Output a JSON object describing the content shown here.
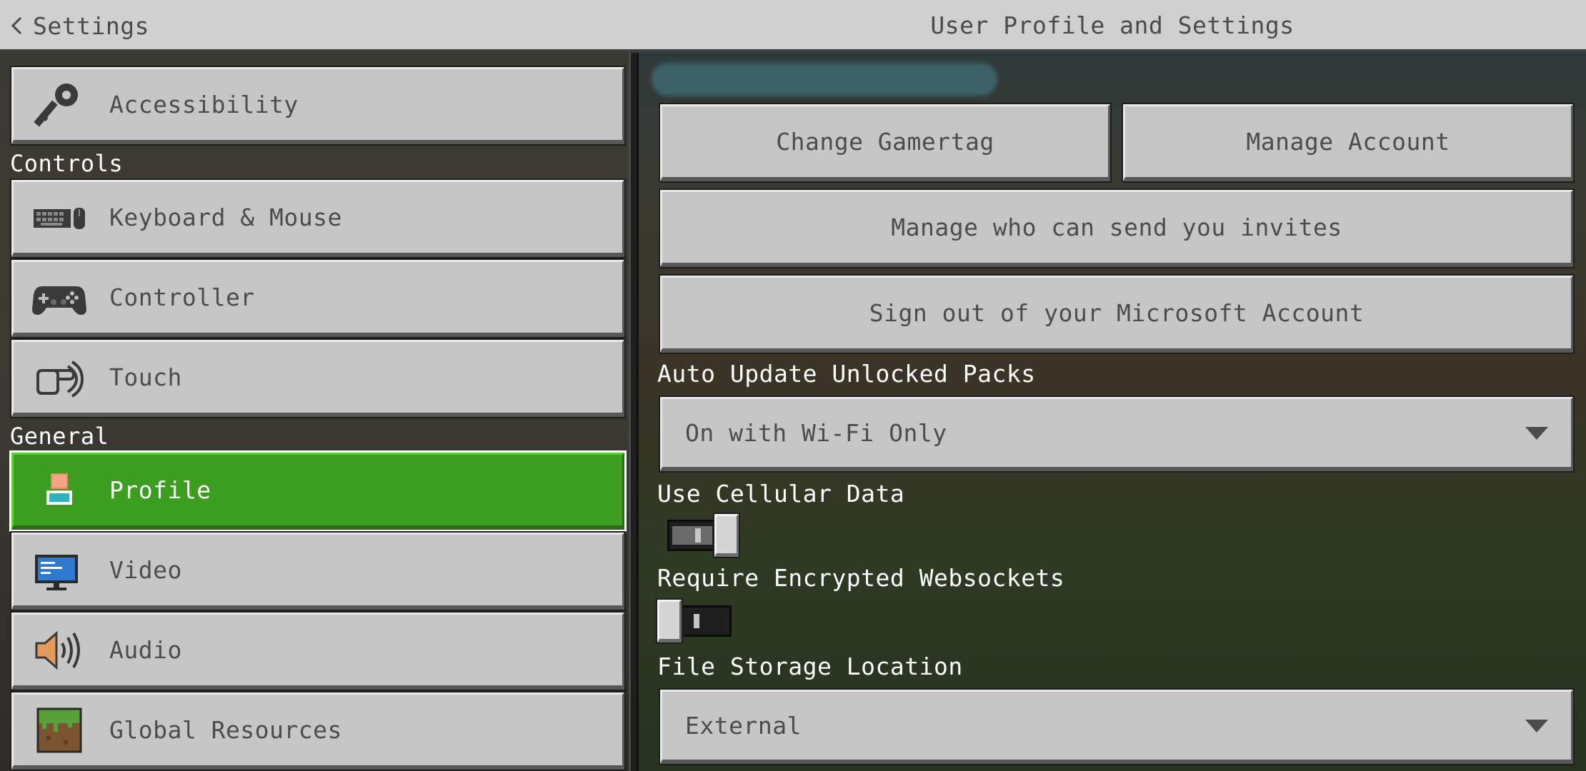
{
  "header": {
    "back_label": "Settings",
    "title": "User Profile and Settings"
  },
  "sidebar": {
    "sections": [
      {
        "label": "Controls"
      },
      {
        "label": "General"
      }
    ],
    "items": [
      {
        "label": "Accessibility",
        "icon": "key-icon",
        "selected": false
      },
      {
        "label": "Keyboard & Mouse",
        "icon": "keyboard-mouse-icon",
        "selected": false
      },
      {
        "label": "Controller",
        "icon": "gamepad-icon",
        "selected": false
      },
      {
        "label": "Touch",
        "icon": "touch-hand-icon",
        "selected": false
      },
      {
        "label": "Profile",
        "icon": "profile-icon",
        "selected": true
      },
      {
        "label": "Video",
        "icon": "monitor-icon",
        "selected": false
      },
      {
        "label": "Audio",
        "icon": "speaker-icon",
        "selected": false
      },
      {
        "label": "Global Resources",
        "icon": "grass-block-icon",
        "selected": false
      }
    ]
  },
  "main": {
    "buttons": {
      "change_gamertag": "Change Gamertag",
      "manage_account": "Manage Account",
      "manage_invites": "Manage who can send you invites",
      "sign_out": "Sign out of your Microsoft Account"
    },
    "auto_update": {
      "label": "Auto Update Unlocked Packs",
      "value": "On with Wi-Fi Only"
    },
    "cellular": {
      "label": "Use Cellular Data",
      "enabled": true
    },
    "encrypted_websockets": {
      "label": "Require Encrypted Websockets",
      "enabled": false
    },
    "file_storage": {
      "label": "File Storage Location",
      "value": "External"
    }
  },
  "colors": {
    "selected_green": "#3c9e1e",
    "button_grey": "#c6c6c6",
    "text_grey": "#4c4c4c",
    "header_grey": "#d0d0d0"
  }
}
